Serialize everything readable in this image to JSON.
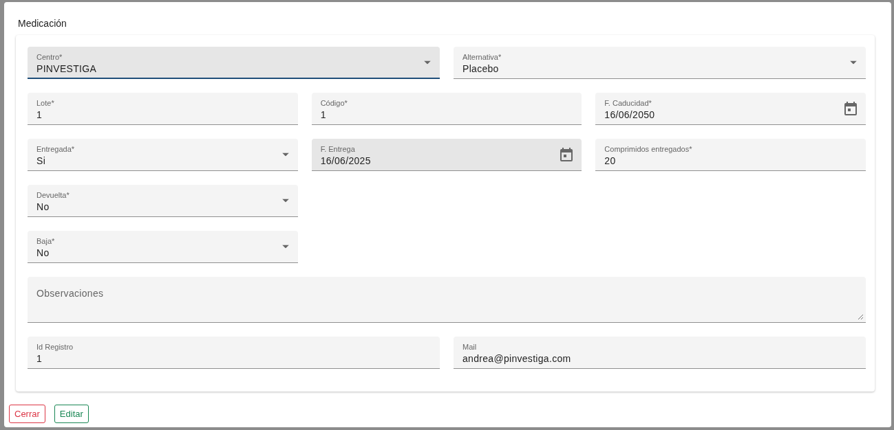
{
  "dialog": {
    "title": "Medicación"
  },
  "rows": [
    {
      "kind": "halves",
      "fields": [
        {
          "kind": "select",
          "label": "Centro*",
          "value": "PINVESTIGA",
          "focused": true,
          "hovered": false
        },
        {
          "kind": "select",
          "label": "Alternativa*",
          "value": "Placebo",
          "focused": false,
          "hovered": false
        }
      ]
    },
    {
      "kind": "thirds",
      "fields": [
        {
          "kind": "text",
          "label": "Lote*",
          "value": "1",
          "focused": false,
          "hovered": false
        },
        {
          "kind": "text",
          "label": "Código*",
          "value": "1",
          "focused": false,
          "hovered": false
        },
        {
          "kind": "date",
          "label": "F. Caducidad*",
          "value": "16/06/2050",
          "focused": false,
          "hovered": false
        }
      ]
    },
    {
      "kind": "thirds",
      "fields": [
        {
          "kind": "select",
          "label": "Entregada*",
          "value": "Si",
          "focused": false,
          "hovered": false
        },
        {
          "kind": "date",
          "label": "F. Entrega",
          "value": "16/06/2025",
          "focused": false,
          "hovered": true
        },
        {
          "kind": "text",
          "label": "Comprimidos entregados*",
          "value": "20",
          "focused": false,
          "hovered": false
        }
      ]
    },
    {
      "kind": "thirds",
      "fields": [
        {
          "kind": "select",
          "label": "Devuelta*",
          "value": "No",
          "focused": false,
          "hovered": false
        }
      ]
    },
    {
      "kind": "thirds",
      "fields": [
        {
          "kind": "select",
          "label": "Baja*",
          "value": "No",
          "focused": false,
          "hovered": false
        }
      ]
    },
    {
      "kind": "full",
      "fields": [
        {
          "kind": "textarea",
          "placeholder": "Observaciones",
          "focused": false,
          "hovered": false
        }
      ]
    },
    {
      "kind": "halves",
      "fields": [
        {
          "kind": "text",
          "label": "Id Registro",
          "value": "1",
          "focused": false,
          "hovered": false
        },
        {
          "kind": "text",
          "label": "Mail",
          "value": "andrea@pinvestiga.com",
          "focused": false,
          "hovered": false
        }
      ]
    }
  ],
  "buttons": [
    {
      "kind": "danger",
      "label": "Cerrar"
    },
    {
      "kind": "success",
      "label": "Editar"
    }
  ]
}
